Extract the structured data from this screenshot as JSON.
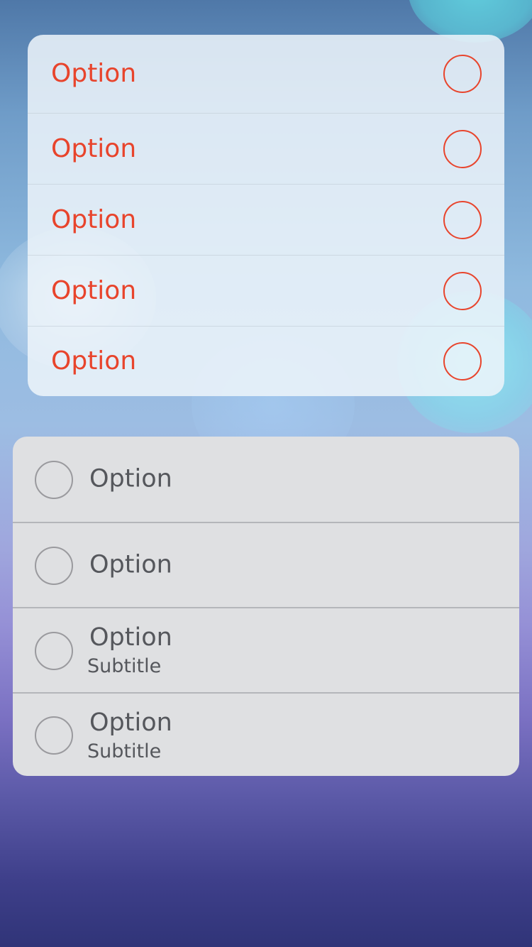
{
  "top_list": {
    "accent_color": "#e8442c",
    "items": [
      {
        "label": "Option",
        "selected": false
      },
      {
        "label": "Option",
        "selected": false
      },
      {
        "label": "Option",
        "selected": false
      },
      {
        "label": "Option",
        "selected": false
      },
      {
        "label": "Option",
        "selected": false
      }
    ]
  },
  "bottom_list": {
    "text_color": "#55575c",
    "items": [
      {
        "label": "Option",
        "selected": false
      },
      {
        "label": "Option",
        "selected": false
      },
      {
        "label": "Option",
        "subtitle": "Subtitle",
        "selected": false
      },
      {
        "label": "Option",
        "subtitle": "Subtitle",
        "selected": false
      }
    ]
  }
}
